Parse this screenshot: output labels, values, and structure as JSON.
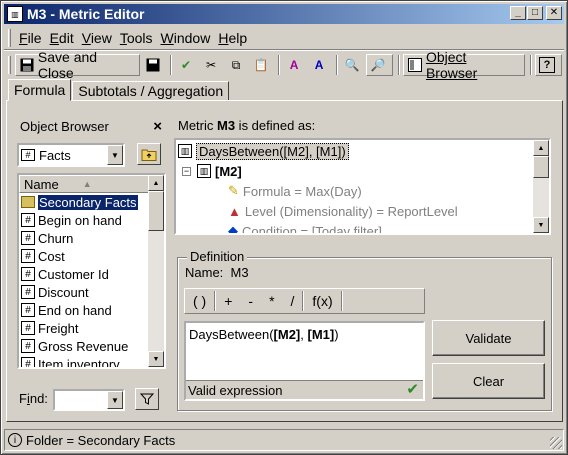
{
  "window": {
    "title": "M3 - Metric Editor",
    "icon": "metric-icon"
  },
  "menu": [
    {
      "pre": "",
      "u": "F",
      "post": "ile"
    },
    {
      "pre": "",
      "u": "E",
      "post": "dit"
    },
    {
      "pre": "",
      "u": "V",
      "post": "iew"
    },
    {
      "pre": "",
      "u": "T",
      "post": "ools"
    },
    {
      "pre": "",
      "u": "W",
      "post": "indow"
    },
    {
      "pre": "",
      "u": "H",
      "post": "elp"
    }
  ],
  "toolbar": {
    "save_close_label": "Save and Close",
    "object_browser_label": "Object Browser"
  },
  "tabs": {
    "formula": "Formula",
    "subtotals": "Subtotals / Aggregation"
  },
  "object_browser": {
    "title": "Object Browser",
    "folder_combo": "Facts",
    "column_header": "Name",
    "items": [
      {
        "label": "Secondary Facts",
        "kind": "folder",
        "selected": true
      },
      {
        "label": "Begin on hand",
        "kind": "fact"
      },
      {
        "label": "Churn",
        "kind": "fact"
      },
      {
        "label": "Cost",
        "kind": "fact"
      },
      {
        "label": "Customer Id",
        "kind": "fact"
      },
      {
        "label": "Discount",
        "kind": "fact"
      },
      {
        "label": "End on hand",
        "kind": "fact"
      },
      {
        "label": "Freight",
        "kind": "fact"
      },
      {
        "label": "Gross Revenue",
        "kind": "fact"
      },
      {
        "label": "Item inventory",
        "kind": "fact"
      }
    ],
    "find_label": "Find:",
    "find_value": ""
  },
  "definition_header": {
    "pre": "Metric ",
    "metric": "M3",
    "post": "  is defined as:"
  },
  "tree": {
    "root": "DaysBetween([M2], [M1])",
    "child": "[M2]",
    "formula": "Formula = Max(Day)",
    "level": "Level (Dimensionality) = ReportLevel",
    "condition": "Condition = [Today filter]"
  },
  "definition": {
    "title": "Definition",
    "name_label": "Name:",
    "name_value": "M3",
    "ops": [
      "( )",
      "+",
      "-",
      "*",
      "/",
      "f(x)"
    ],
    "formula_pre": "DaysBetween(",
    "formula_b1": "[M2]",
    "formula_mid": ", ",
    "formula_b2": "[M1]",
    "formula_post": ")",
    "status": "Valid expression",
    "validate_label": "Validate",
    "clear_label": "Clear"
  },
  "status_bar": {
    "text": "Folder = Secondary Facts"
  }
}
